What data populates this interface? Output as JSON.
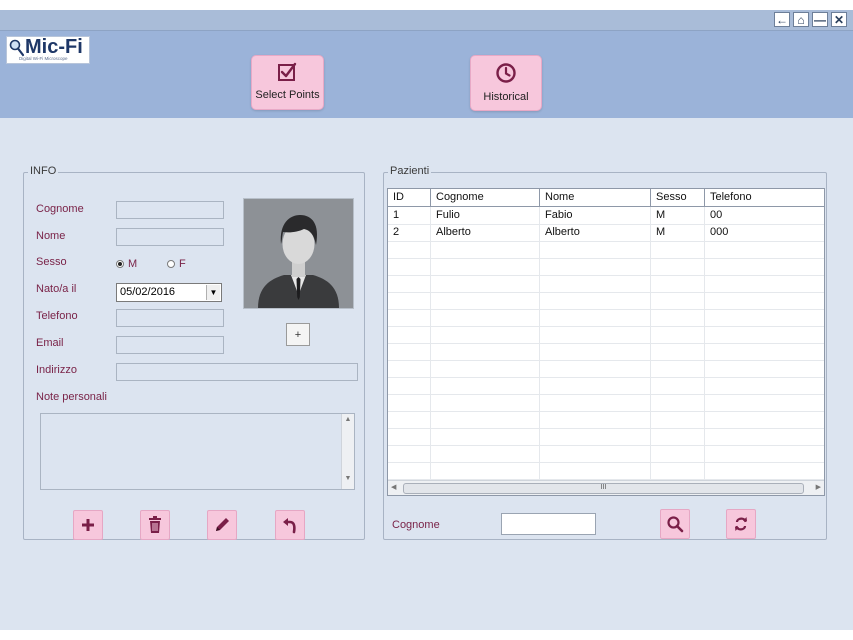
{
  "window": {
    "controls": [
      {
        "name": "back-icon",
        "glyph": "←"
      },
      {
        "name": "home-icon",
        "glyph": "⌂"
      },
      {
        "name": "minimize-icon",
        "glyph": "—"
      },
      {
        "name": "close-icon",
        "glyph": "✕"
      }
    ]
  },
  "logo": {
    "text": "Mic-Fi",
    "subtitle": "Digital Wi-Fi Microscope"
  },
  "toolbar": {
    "select_points": "Select Points",
    "historical": "Historical"
  },
  "info": {
    "legend": "INFO",
    "cognome_label": "Cognome",
    "nome_label": "Nome",
    "sesso_label": "Sesso",
    "sesso_m": "M",
    "sesso_f": "F",
    "sesso_selected": "M",
    "nato_label": "Nato/a il",
    "nato_value": "05/02/2016",
    "telefono_label": "Telefono",
    "email_label": "Email",
    "indirizzo_label": "Indirizzo",
    "note_label": "Note personali",
    "add_photo": "+"
  },
  "pazienti": {
    "legend": "Pazienti",
    "columns": [
      "ID",
      "Cognome",
      "Nome",
      "Sesso",
      "Telefono"
    ],
    "rows": [
      [
        "1",
        "Fulio",
        "Fabio",
        "M",
        "00"
      ],
      [
        "2",
        "Alberto",
        "Alberto",
        "M",
        "000"
      ]
    ],
    "search_label": "Cognome",
    "scroll_grip": "III"
  },
  "colors": {
    "accent": "#f7c7dc",
    "icon": "#7a1f48",
    "header": "#9bb3d9",
    "background": "#dce4f0"
  }
}
